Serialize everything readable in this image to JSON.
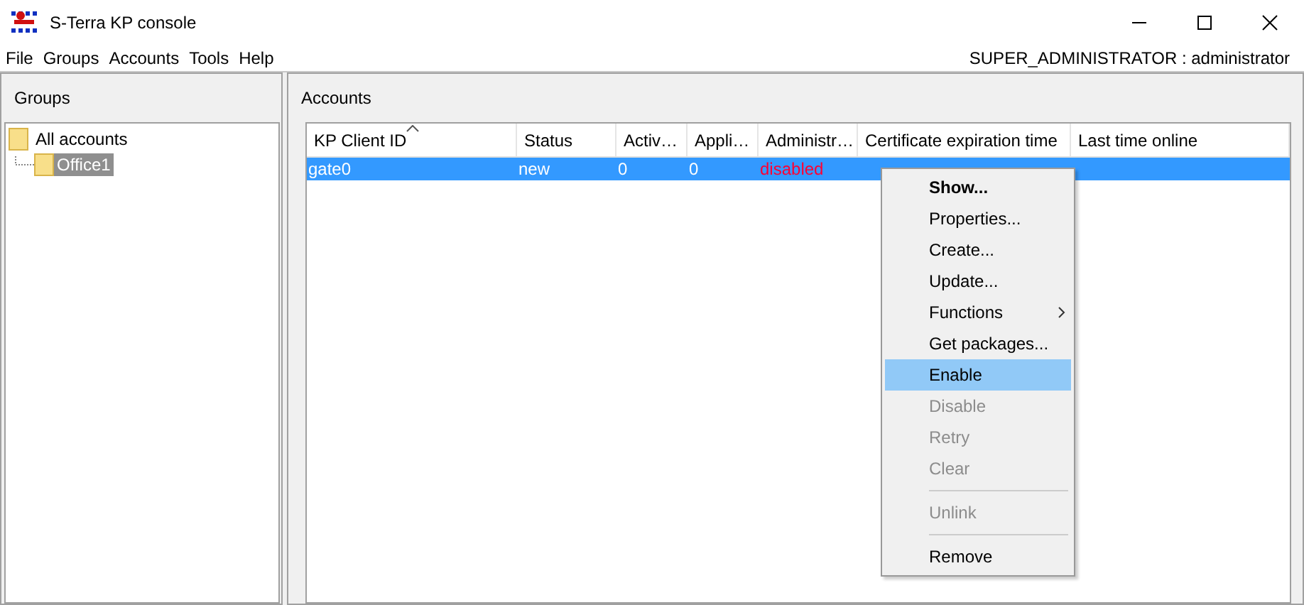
{
  "window": {
    "title": "S-Terra KP console"
  },
  "menu": [
    "File",
    "Groups",
    "Accounts",
    "Tools",
    "Help"
  ],
  "user": "SUPER_ADMINISTRATOR : administrator",
  "groups_panel": {
    "title": "Groups",
    "tree": [
      {
        "label": "All accounts",
        "selected": false,
        "children": [
          {
            "label": "Office1",
            "selected": true
          }
        ]
      }
    ]
  },
  "accounts_panel": {
    "title": "Accounts",
    "table": {
      "columns": [
        {
          "label": "KP Client ID",
          "sorted": true
        },
        {
          "label": "Status",
          "sorted": false
        },
        {
          "label": "Activ…",
          "sorted": false
        },
        {
          "label": "Appli…",
          "sorted": false
        },
        {
          "label": "Administr…",
          "sorted": false
        },
        {
          "label": "Certificate expiration time",
          "sorted": false
        },
        {
          "label": "Last time online",
          "sorted": false
        }
      ],
      "rows": [
        {
          "selected": true,
          "cells": [
            {
              "text": "gate0",
              "warning": false
            },
            {
              "text": "new",
              "warning": false
            },
            {
              "text": "0",
              "warning": false
            },
            {
              "text": "0",
              "warning": false
            },
            {
              "text": "disabled",
              "warning": true
            }
          ]
        }
      ]
    }
  },
  "context_menu": [
    {
      "kind": "item",
      "label": "Show...",
      "default": true,
      "disabled": false,
      "selected": false,
      "submenu": false
    },
    {
      "kind": "item",
      "label": "Properties...",
      "default": false,
      "disabled": false,
      "selected": false,
      "submenu": false
    },
    {
      "kind": "item",
      "label": "Create...",
      "default": false,
      "disabled": false,
      "selected": false,
      "submenu": false
    },
    {
      "kind": "item",
      "label": "Update...",
      "default": false,
      "disabled": false,
      "selected": false,
      "submenu": false
    },
    {
      "kind": "item",
      "label": "Functions",
      "default": false,
      "disabled": false,
      "selected": false,
      "submenu": true
    },
    {
      "kind": "item",
      "label": "Get packages...",
      "default": false,
      "disabled": false,
      "selected": false,
      "submenu": false
    },
    {
      "kind": "item",
      "label": "Enable",
      "default": false,
      "disabled": false,
      "selected": true,
      "submenu": false
    },
    {
      "kind": "item",
      "label": "Disable",
      "default": false,
      "disabled": true,
      "selected": false,
      "submenu": false
    },
    {
      "kind": "item",
      "label": "Retry",
      "default": false,
      "disabled": true,
      "selected": false,
      "submenu": false
    },
    {
      "kind": "item",
      "label": "Clear",
      "default": false,
      "disabled": true,
      "selected": false,
      "submenu": false
    },
    {
      "kind": "separator"
    },
    {
      "kind": "item",
      "label": "Unlink",
      "default": false,
      "disabled": true,
      "selected": false,
      "submenu": false
    },
    {
      "kind": "separator"
    },
    {
      "kind": "item",
      "label": "Remove",
      "default": false,
      "disabled": false,
      "selected": false,
      "submenu": false
    }
  ]
}
